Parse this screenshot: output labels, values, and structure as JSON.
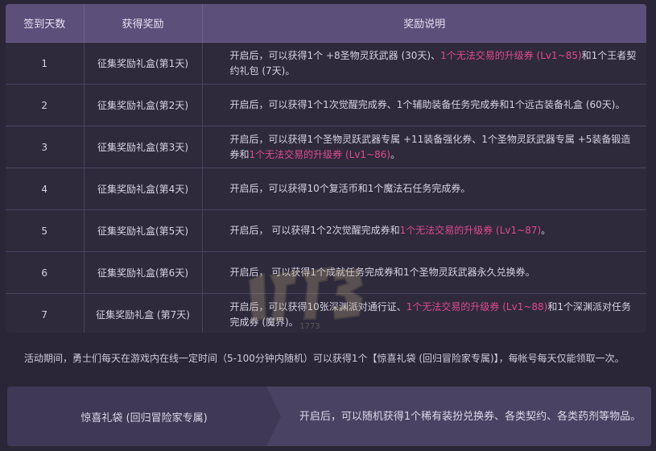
{
  "table": {
    "headers": [
      "签到天数",
      "获得奖励",
      "奖励说明"
    ],
    "rows": [
      {
        "day": "1",
        "reward": "征集奖励礼盒(第1天)",
        "desc": [
          {
            "t": "开启后，可以获得1个 +8圣物灵跃武器 (30天)、",
            "h": false
          },
          {
            "t": "1个无法交易的升级券 (Lv1~85)",
            "h": true
          },
          {
            "t": "和1个王者契约礼包 (7天)。",
            "h": false
          }
        ]
      },
      {
        "day": "2",
        "reward": "征集奖励礼盒(第2天)",
        "desc": [
          {
            "t": "开启后，可以获得1个1次觉醒完成券、1个辅助装备任务完成券和1个远古装备礼盒 (60天)。",
            "h": false
          }
        ]
      },
      {
        "day": "3",
        "reward": "征集奖励礼盒(第3天)",
        "desc": [
          {
            "t": "开启后，可以获得1个圣物灵跃武器专属 +11装备强化券、1个圣物灵跃武器专属 +5装备锻造券和",
            "h": false
          },
          {
            "t": "1个无法交易的升级券 (Lv1~86)",
            "h": true
          },
          {
            "t": "。",
            "h": false
          }
        ]
      },
      {
        "day": "4",
        "reward": "征集奖励礼盒(第4天)",
        "desc": [
          {
            "t": "开启后，可以获得10个复活币和1个魔法石任务完成券。",
            "h": false
          }
        ]
      },
      {
        "day": "5",
        "reward": "征集奖励礼盒(第5天)",
        "desc": [
          {
            "t": "开启后， 可以获得1个2次觉醒完成券和",
            "h": false
          },
          {
            "t": "1个无法交易的升级券 (Lv1~87)",
            "h": true
          },
          {
            "t": "。",
            "h": false
          }
        ]
      },
      {
        "day": "6",
        "reward": "征集奖励礼盒(第6天)",
        "desc": [
          {
            "t": "开启后， 可以获得1个成就任务完成券和1个圣物灵跃武器永久兑换券。",
            "h": false
          }
        ]
      },
      {
        "day": "7",
        "reward": "征集奖励礼盒 (第7天)",
        "desc": [
          {
            "t": "开启后，可以获得10张深渊派对通行证、",
            "h": false
          },
          {
            "t": "1个无法交易的升级券 (Lv1~88)",
            "h": true
          },
          {
            "t": "和1个深渊派对任务完成券 (魔界)。",
            "h": false
          }
        ]
      }
    ]
  },
  "note": "活动期间，勇士们每天在游戏内在线一定时间（5-100分钟内随机）可以获得1个【惊喜礼袋 (回归冒险家专属)】，每帐号每天仅能领取一次。",
  "bag": {
    "name": "惊喜礼袋 (回归冒险家专属)",
    "desc": "开启后，可以随机获得1个稀有装扮兑换券、各类契约、各类药剂等物品。"
  },
  "watermark": {
    "text": "1773"
  },
  "colors": {
    "highlight": "#e0498f",
    "header_bg": "#5c4f79",
    "page_bg": "#2a2637"
  }
}
